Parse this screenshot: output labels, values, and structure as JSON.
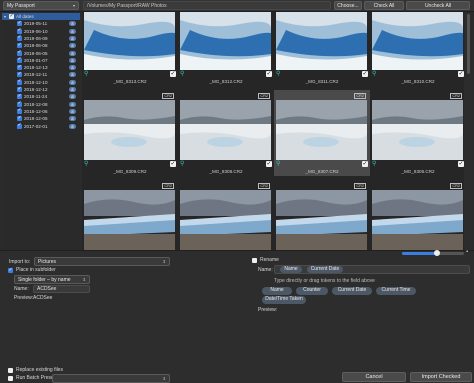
{
  "header": {
    "device": "My Passport",
    "path": "/Volumes/My Passport/RAW Photos",
    "choose_label": "Choose...",
    "check_all_label": "Check All",
    "uncheck_all_label": "Uncheck All"
  },
  "sidebar": {
    "all_label": "All dates",
    "all_count": "",
    "dates": [
      {
        "label": "2019-05-11",
        "count": "8"
      },
      {
        "label": "2019-06-10",
        "count": "8"
      },
      {
        "label": "2019-06-09",
        "count": "8"
      },
      {
        "label": "2019-06-08",
        "count": "8"
      },
      {
        "label": "2019-06-05",
        "count": "8"
      },
      {
        "label": "2019-01-07",
        "count": "8"
      },
      {
        "label": "2018-12-13",
        "count": "8"
      },
      {
        "label": "2018-12-11",
        "count": "8"
      },
      {
        "label": "2018-12-10",
        "count": "8"
      },
      {
        "label": "2018-12-12",
        "count": "8"
      },
      {
        "label": "2018-11-24",
        "count": "8"
      },
      {
        "label": "2018-12-08",
        "count": "8"
      },
      {
        "label": "2018-12-06",
        "count": "8"
      },
      {
        "label": "2018-12-05",
        "count": "8"
      },
      {
        "label": "2017-02-01",
        "count": "8"
      }
    ]
  },
  "grid": {
    "rows": [
      [
        {
          "name": "_MG_8313.CR2",
          "badge": ""
        },
        {
          "name": "_MG_8312.CR2",
          "badge": ""
        },
        {
          "name": "_MG_8311.CR2",
          "badge": ""
        },
        {
          "name": "_MG_8310.CR2",
          "badge": ""
        }
      ],
      [
        {
          "name": "_MG_8309.CR2",
          "badge": "CR2"
        },
        {
          "name": "_MG_8308.CR2",
          "badge": "CR2"
        },
        {
          "name": "_MG_8307.CR2",
          "badge": "CR2"
        },
        {
          "name": "_MG_8306.CR2",
          "badge": "CR2"
        }
      ],
      [
        {
          "name": "",
          "badge": "CR2"
        },
        {
          "name": "",
          "badge": "CR2"
        },
        {
          "name": "",
          "badge": "CR2"
        },
        {
          "name": "",
          "badge": "CR2"
        }
      ]
    ]
  },
  "import": {
    "import_to_label": "Import to:",
    "import_to_value": "Pictures",
    "place_subfolder_label": "Place in subfolder",
    "subfolder_mode": "Single folder – by name",
    "name_label": "Name:",
    "name_value": "ACDSee",
    "preview_label": "Preview:",
    "preview_value": "ACDSee",
    "replace_label": "Replace existing files",
    "batch_label": "Run Batch Preset",
    "batch_value": ""
  },
  "rename": {
    "rename_label": "Rename",
    "name_label": "Name:",
    "current_tokens": [
      "Name",
      "Current Date"
    ],
    "hint": "Type directly or drag tokens to the field above",
    "tokens": [
      "Name",
      "Counter",
      "Current Date",
      "Current Time",
      "Date/Time Taken"
    ],
    "preview_label": "Preview:"
  },
  "footer": {
    "cancel_label": "Cancel",
    "import_label": "Import Checked"
  },
  "colors": {
    "accent": "#3b7de0",
    "pin": "#3ec7c2",
    "selection": "#2f5d9c"
  }
}
